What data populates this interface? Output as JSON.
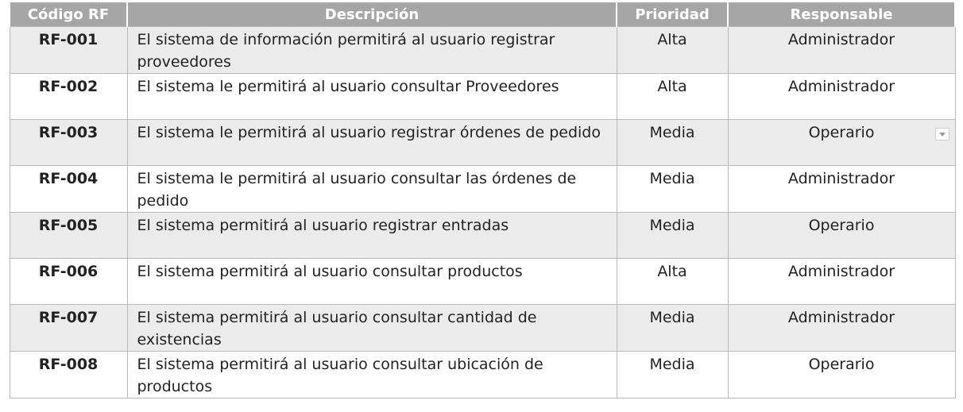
{
  "headers": [
    "Código RF",
    "Descripción",
    "Prioridad",
    "Responsable"
  ],
  "rows": [
    {
      "code": "RF-001",
      "desc": "El sistema de información permitirá al usuario registrar proveedores",
      "prio": "Alta",
      "resp": "Administrador"
    },
    {
      "code": "RF-002",
      "desc": "El sistema le permitirá al usuario consultar Proveedores",
      "prio": "Alta",
      "resp": "Administrador"
    },
    {
      "code": "RF-003",
      "desc": "El sistema le permitirá al usuario registrar órdenes de pedido",
      "prio": "Media",
      "resp": "Operario"
    },
    {
      "code": "RF-004",
      "desc": "El sistema le permitirá al usuario consultar las órdenes de pedido",
      "prio": "Media",
      "resp": "Administrador"
    },
    {
      "code": "RF-005",
      "desc": "El sistema permitirá al usuario registrar entradas",
      "prio": "Media",
      "resp": "Operario"
    },
    {
      "code": "RF-006",
      "desc": "El sistema permitirá al usuario consultar productos",
      "prio": "Alta",
      "resp": "Administrador"
    },
    {
      "code": "RF-007",
      "desc": "El sistema permitirá al usuario consultar cantidad de existencias",
      "prio": "Media",
      "resp": "Administrador"
    },
    {
      "code": "RF-008",
      "desc": "El sistema permitirá al usuario consultar ubicación de productos",
      "prio": "Media",
      "resp": "Operario"
    }
  ],
  "colors": {
    "header_bg": "#a6a6a6",
    "header_text": "#ffffff",
    "row_shade": "#ebebeb",
    "row_plain": "#ffffff",
    "border": "#b9b9b9"
  },
  "icons": {
    "dropdown": "chevron-down-icon"
  }
}
